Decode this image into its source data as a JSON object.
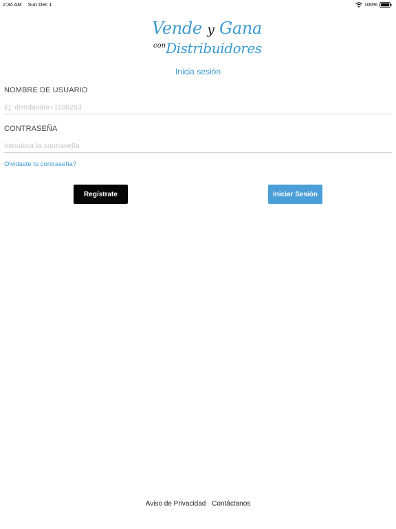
{
  "status_bar": {
    "time": "2:34 AM",
    "date": "Sun Dec 1",
    "battery": "100%",
    "icons": [
      "wifi-icon",
      "battery-icon"
    ]
  },
  "logo": {
    "word1": "Vende",
    "word2": "y",
    "word3": "Gana",
    "word4": "con",
    "word5": "Distribuidores"
  },
  "title": "Inicia sesión",
  "form": {
    "username_label": "NOMBRE DE USUARIO",
    "username_placeholder": "Ej: distribuidor+1106293",
    "username_value": "",
    "password_label": "CONTRASEÑA",
    "password_placeholder": "Introducir la contraseña",
    "password_value": "",
    "forgot_link": "Olvidaste tu contraseña?"
  },
  "buttons": {
    "register": "Regístrate",
    "login": "Iniciar Sesión"
  },
  "footer": {
    "privacy": "Aviso de Privacidad",
    "contact": "Contáctanos"
  },
  "colors": {
    "accent": "#3b9ad2",
    "login_button": "#4a9fd8",
    "register_button": "#050505"
  }
}
